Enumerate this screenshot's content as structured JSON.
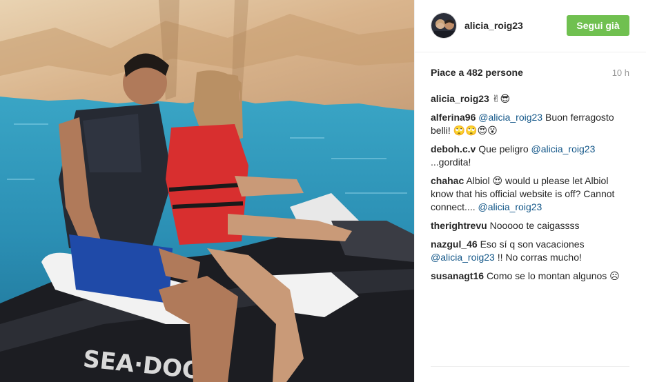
{
  "post": {
    "username": "alicia_roig23",
    "follow_label": "Segui già",
    "likes_text": "Piace a 482 persone",
    "time_ago": "10 h"
  },
  "comments": [
    {
      "user": "alicia_roig23",
      "parts": [
        {
          "type": "text",
          "text": "✌😎"
        }
      ]
    },
    {
      "user": "alferina96",
      "parts": [
        {
          "type": "mention",
          "text": "@alicia_roig23"
        },
        {
          "type": "text",
          "text": " Buon ferragosto belli! 🙄🙄😍😮"
        }
      ]
    },
    {
      "user": "deboh.c.v",
      "parts": [
        {
          "type": "text",
          "text": "Que peligro "
        },
        {
          "type": "mention",
          "text": "@alicia_roig23"
        },
        {
          "type": "text",
          "text": " ...gordita!"
        }
      ]
    },
    {
      "user": "chahac",
      "parts": [
        {
          "type": "text",
          "text": "Albiol 😍 would u please let Albiol know that his official website is off? Cannot connect.... "
        },
        {
          "type": "mention",
          "text": "@alicia_roig23"
        }
      ]
    },
    {
      "user": "therightrevu",
      "parts": [
        {
          "type": "text",
          "text": "Nooooo te caigassss"
        }
      ]
    },
    {
      "user": "nazgul_46",
      "parts": [
        {
          "type": "text",
          "text": "Eso sí q son vacaciones "
        },
        {
          "type": "mention",
          "text": "@alicia_roig23"
        },
        {
          "type": "text",
          "text": " !! No corras mucho!"
        }
      ]
    },
    {
      "user": "susanagt16",
      "parts": [
        {
          "type": "text",
          "text": "Como se lo montan algunos ☹"
        }
      ]
    }
  ],
  "colors": {
    "follow_button": "#70c050",
    "mention": "#125688",
    "muted": "#999999"
  },
  "icons": {
    "photo": "jet-ski-photo",
    "avatar": "profile-picture"
  }
}
